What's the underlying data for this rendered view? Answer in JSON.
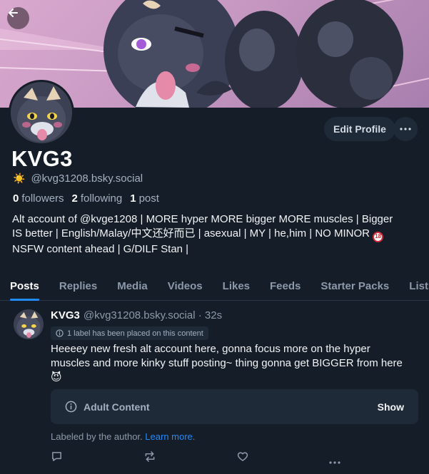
{
  "profile": {
    "display_name": "KVG3",
    "handle_emoji": "☀️",
    "handle": "@kvg31208.bsky.social",
    "stats": {
      "followers_count": "0",
      "followers_label": "followers",
      "following_count": "2",
      "following_label": "following",
      "posts_count": "1",
      "posts_label": "post"
    },
    "bio_lines": [
      "Alt account of @kvge1208 | MORE hyper MORE bigger MORE muscles | Bigger",
      "IS better | English/Malay/中文还好而已 | asexual | MY | he,him | NO MINOR",
      "NSFW content ahead | G/DILF Stan |"
    ],
    "bio_badge": "18",
    "edit_label": "Edit Profile"
  },
  "tabs": [
    {
      "label": "Posts",
      "active": true
    },
    {
      "label": "Replies",
      "active": false
    },
    {
      "label": "Media",
      "active": false
    },
    {
      "label": "Videos",
      "active": false
    },
    {
      "label": "Likes",
      "active": false
    },
    {
      "label": "Feeds",
      "active": false
    },
    {
      "label": "Starter Packs",
      "active": false
    },
    {
      "label": "Lists",
      "active": false
    }
  ],
  "post": {
    "author": "KVG3",
    "meta": "@kvg31208.bsky.social · 32s",
    "label_notice": "1 label has been placed on this content",
    "text": "Heeeey new fresh alt account here, gonna focus more on the hyper muscles and more kinky stuff posting~ thing gonna get BIGGER from here 😈",
    "warning_title": "Adult Content",
    "warning_action": "Show",
    "labeled_by": "Labeled by the author.",
    "learn_more": "Learn more."
  },
  "colors": {
    "background": "#151d28",
    "accent": "#208bfe",
    "surface": "#1e2a38",
    "muted_text": "#8c99aa"
  },
  "icons": [
    "back-arrow-icon",
    "more-horizontal-icon",
    "info-circle-icon",
    "reply-icon",
    "repost-icon",
    "like-icon",
    "more-options-icon"
  ]
}
